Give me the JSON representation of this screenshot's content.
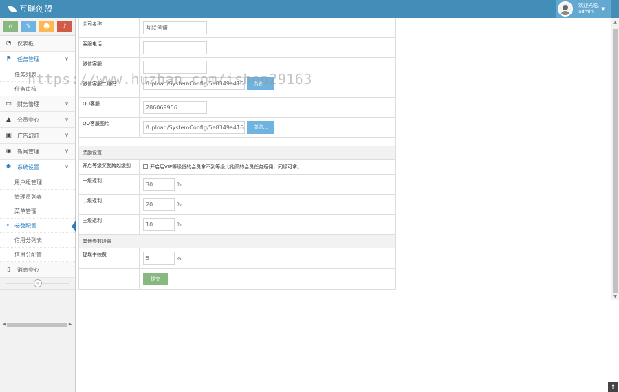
{
  "header": {
    "brand": "互联创盟",
    "welcome": "欢迎光临,",
    "username": "admin"
  },
  "shortcuts": [
    {
      "icon": "home-icon",
      "glyph": "⌂",
      "color": "#87b87f"
    },
    {
      "icon": "pencil-icon",
      "glyph": "✎",
      "color": "#6fb3e0"
    },
    {
      "icon": "users-icon",
      "glyph": "☻",
      "color": "#ffb752"
    },
    {
      "icon": "bell-icon",
      "glyph": "♪",
      "color": "#d15b47"
    }
  ],
  "sidebar": {
    "dashboard": "仪表板",
    "task_management": "任务管理",
    "task_sub1": "任务列表",
    "task_sub2": "任务审核",
    "finance": "财务管理",
    "members": "会员中心",
    "ads": "广告幻灯",
    "news": "新闻管理",
    "system": "系统设置",
    "system_sub": [
      "用户组管理",
      "管理员列表",
      "菜单管理",
      "参数配置",
      "信用分列表",
      "信用分配置"
    ],
    "messages": "消息中心",
    "collapse": "«"
  },
  "form": {
    "company_name_label": "公司名称",
    "company_name_value": "互联创盟",
    "service_phone_label": "客服电话",
    "service_phone_value": "",
    "wechat_label": "微信客服",
    "wechat_value": "",
    "wechat_img_label": "微信客服二维码",
    "wechat_img_value": "/Upload/SystemConfig/5e8349a416d2",
    "browse_label": "浏览...",
    "qq_label": "QQ客服",
    "qq_value": "286069956",
    "qq_img_label": "QQ客服图片",
    "qq_img_value": "/Upload/SystemConfig/5e8349a416d2"
  },
  "rebate": {
    "section_title": "奖励设置",
    "cross_label": "开启等级奖励跨越级别",
    "cross_text": "开启后VIP等级低的会员拿不到等级比他高的会员任务返佣，同级可拿。",
    "level1_label": "一级返利",
    "level1_value": "30",
    "level2_label": "二级返利",
    "level2_value": "20",
    "level3_label": "三级返利",
    "level3_value": "10",
    "percent": "%"
  },
  "other": {
    "section_title": "其他参数设置",
    "fee_label": "提现手续费",
    "fee_value": "5",
    "percent": "%",
    "submit": "提交"
  },
  "watermark": "https://www.huzhan.com/ishop29163",
  "misc": {
    "to_top": "«"
  }
}
